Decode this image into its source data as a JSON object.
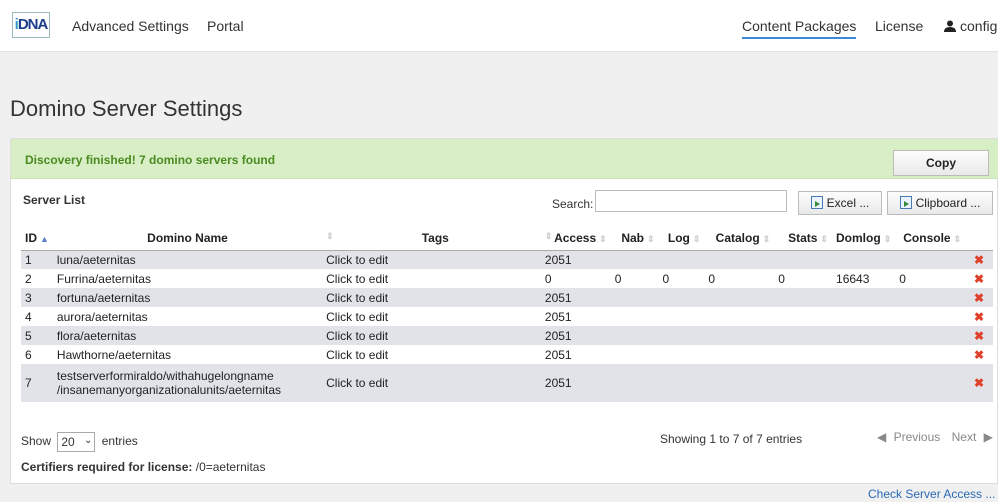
{
  "nav": {
    "logo": {
      "pre": "i",
      "post": "DNA"
    },
    "advanced": "Advanced Settings",
    "portal": "Portal",
    "content_packages": "Content Packages",
    "license": "License",
    "user": "config"
  },
  "page": {
    "title": "Domino Server Settings"
  },
  "alert": {
    "text": "Discovery finished! 7 domino servers found",
    "copy": "Copy"
  },
  "list": {
    "title": "Server List",
    "search_label": "Search:",
    "search_value": "",
    "excel": "Excel ...",
    "clipboard": "Clipboard ...",
    "columns": [
      "ID",
      "Domino Name",
      "Tags",
      "Access",
      "Nab",
      "Log",
      "Catalog",
      "Stats",
      "Domlog",
      "Console"
    ],
    "rows": [
      {
        "id": "1",
        "name": "luna/aeternitas",
        "tags": "Click to edit",
        "access": "2051",
        "nab": "",
        "log": "",
        "catalog": "",
        "stats": "",
        "domlog": "",
        "console": ""
      },
      {
        "id": "2",
        "name": "Furrina/aeternitas",
        "tags": "Click to edit",
        "access": "0",
        "nab": "0",
        "log": "0",
        "catalog": "0",
        "stats": "0",
        "domlog": "16643",
        "console": "0"
      },
      {
        "id": "3",
        "name": "fortuna/aeternitas",
        "tags": "Click to edit",
        "access": "2051",
        "nab": "",
        "log": "",
        "catalog": "",
        "stats": "",
        "domlog": "",
        "console": ""
      },
      {
        "id": "4",
        "name": "aurora/aeternitas",
        "tags": "Click to edit",
        "access": "2051",
        "nab": "",
        "log": "",
        "catalog": "",
        "stats": "",
        "domlog": "",
        "console": ""
      },
      {
        "id": "5",
        "name": "flora/aeternitas",
        "tags": "Click to edit",
        "access": "2051",
        "nab": "",
        "log": "",
        "catalog": "",
        "stats": "",
        "domlog": "",
        "console": ""
      },
      {
        "id": "6",
        "name": "Hawthorne/aeternitas",
        "tags": "Click to edit",
        "access": "2051",
        "nab": "",
        "log": "",
        "catalog": "",
        "stats": "",
        "domlog": "",
        "console": ""
      },
      {
        "id": "7",
        "name_line1": "testserverformiraldo/withahugelongname",
        "name_line2": "/insanemanyorganizationalunits/aeternitas",
        "tags": "Click to edit",
        "access": "2051",
        "nab": "",
        "log": "",
        "catalog": "",
        "stats": "",
        "domlog": "",
        "console": ""
      }
    ],
    "delete_glyph": "✖"
  },
  "footer": {
    "show": "Show",
    "entries_value": "20",
    "entries": "entries",
    "info": "Showing 1 to 7 of 7 entries",
    "previous": "Previous",
    "next": "Next",
    "cert_label": "Certifiers required for license:",
    "cert_value": "/0=aeternitas"
  },
  "check_link": "Check Server Access ..."
}
